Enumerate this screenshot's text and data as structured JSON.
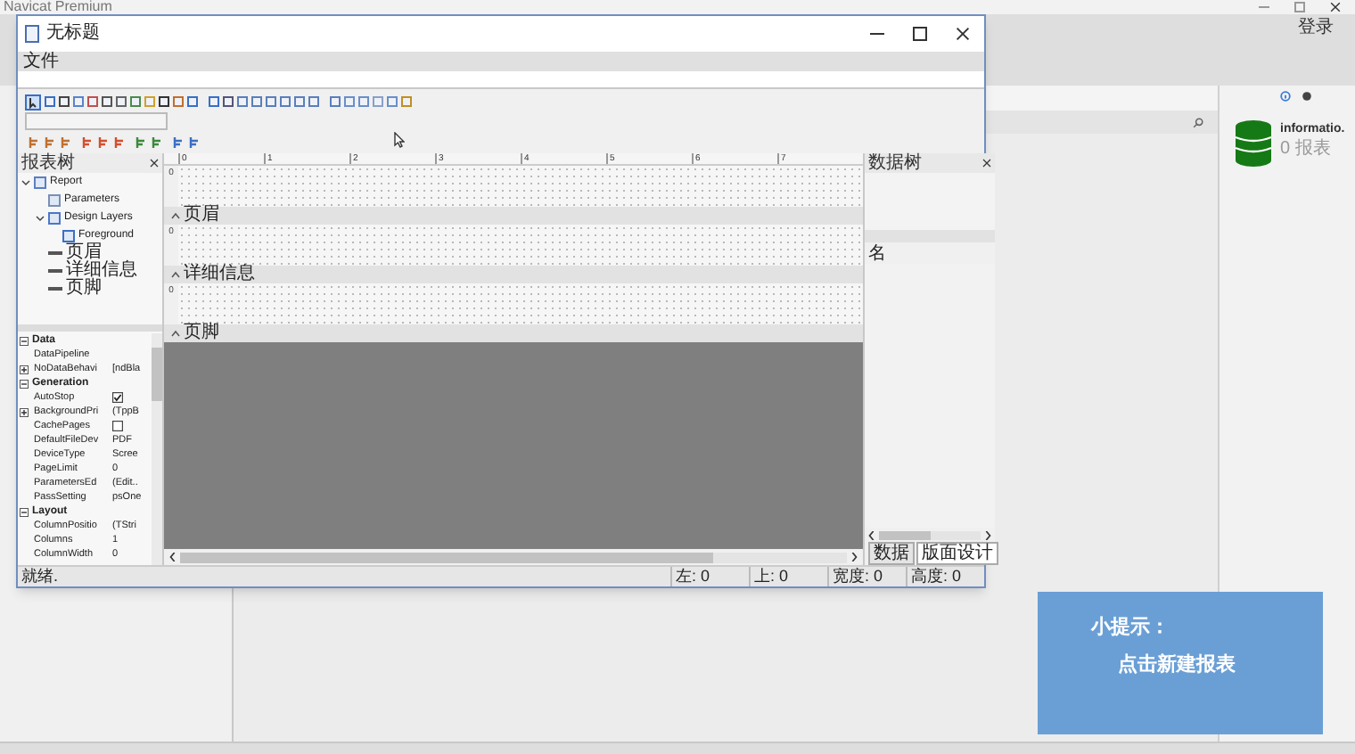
{
  "app": {
    "title": "Navicat Premium",
    "login": "登录",
    "objects": [
      {
        "name": "informatio.",
        "count": "0 报表"
      }
    ]
  },
  "dialog": {
    "title": "无标题",
    "menu": [
      "文件"
    ],
    "report_tree": {
      "title": "报表树",
      "items": [
        {
          "label": "Report",
          "kind": "report",
          "expanded": true,
          "children": [
            {
              "label": "Parameters",
              "kind": "params"
            },
            {
              "label": "Design Layers",
              "kind": "layers",
              "expanded": true,
              "children": [
                {
                  "label": "Foreground",
                  "kind": "layer"
                }
              ]
            },
            {
              "label": "页眉",
              "kind": "band"
            },
            {
              "label": "详细信息",
              "kind": "band"
            },
            {
              "label": "页脚",
              "kind": "band"
            }
          ]
        }
      ]
    },
    "properties": [
      {
        "name": "Data",
        "expanded": true,
        "rows": [
          {
            "kind": "text",
            "name": "DataPipeline"
          },
          {
            "kind": "text",
            "name": "NoDataBehavi",
            "value": "[ndBla",
            "expandable": true
          }
        ]
      },
      {
        "name": "Generation",
        "expanded": true,
        "rows": [
          {
            "kind": "checkbox",
            "name": "AutoStop",
            "checked": true
          },
          {
            "kind": "text",
            "name": "BackgroundPri",
            "value": "(TppB",
            "expandable": true
          },
          {
            "kind": "checkbox",
            "name": "CachePages",
            "checked": false
          },
          {
            "kind": "text",
            "name": "DefaultFileDev",
            "value": "PDF"
          },
          {
            "kind": "text",
            "name": "DeviceType",
            "value": "Scree"
          },
          {
            "kind": "text",
            "name": "PageLimit",
            "value": "0"
          },
          {
            "kind": "text",
            "name": "ParametersEd",
            "value": "(Edit.."
          },
          {
            "kind": "text",
            "name": "PassSetting",
            "value": "psOne"
          }
        ]
      },
      {
        "name": "Layout",
        "expanded": true,
        "rows": [
          {
            "kind": "text",
            "name": "ColumnPositio",
            "value": "(TStri"
          },
          {
            "kind": "text",
            "name": "Columns",
            "value": "1"
          },
          {
            "kind": "text",
            "name": "ColumnWidth",
            "value": "0"
          }
        ]
      }
    ],
    "ruler": [
      "0",
      "1",
      "2",
      "3",
      "4",
      "5",
      "6",
      "7"
    ],
    "bands": [
      {
        "label": "页眉",
        "ruler": "0"
      },
      {
        "label": "详细信息",
        "ruler": "0"
      },
      {
        "label": "页脚",
        "ruler": "0"
      }
    ],
    "data_tree": {
      "title": "数据树",
      "column": "名",
      "tabs": [
        {
          "label": "数据",
          "selected": false
        },
        {
          "label": "版面设计",
          "selected": true
        }
      ]
    },
    "status_bar": [
      "就绪.",
      "左: 0",
      "上: 0",
      "宽度: 0",
      "高度: 0"
    ]
  },
  "hint": {
    "title": "小提示：",
    "text": "点击新建报表"
  }
}
